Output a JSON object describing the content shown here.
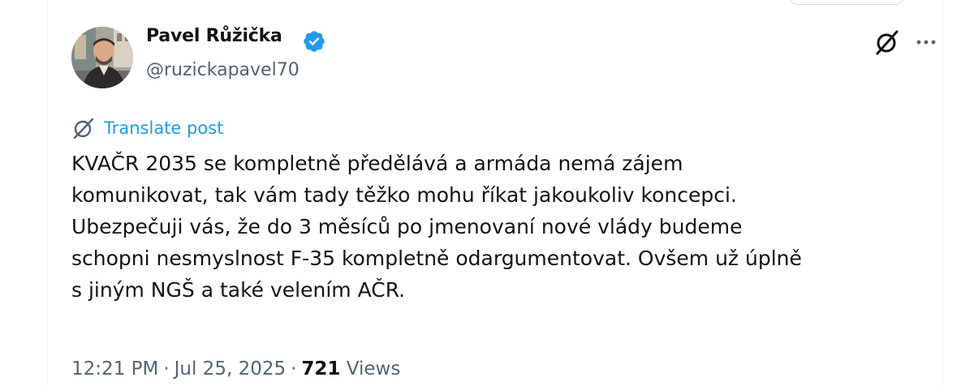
{
  "author": {
    "display_name": "Pavel Růžička",
    "handle": "@ruzickapavel70",
    "verified": true,
    "verified_color": "#1d9bf0"
  },
  "actions": {
    "grok_icon": "grok-icon",
    "more_icon": "more-icon"
  },
  "translate": {
    "label": "Translate post",
    "icon": "translate-icon",
    "color": "#1d9bf0"
  },
  "post": {
    "lines": [
      "KVAČR 2035 se kompletně předělává a armáda nemá zájem",
      "komunikovat, tak vám tady těžko mohu říkat jakoukoliv koncepci.",
      "Ubezpečuji vás, že do 3 měsíců po jmenovaní nové vlády budeme",
      "schopni nesmyslnost F-35 kompletně odargumentovat. Ovšem už úplně",
      "s jiným NGŠ a také velením AČR."
    ]
  },
  "meta": {
    "time": "12:21 PM",
    "separator": "·",
    "date": "Jul 25, 2025",
    "views_count": "721",
    "views_label": "Views"
  }
}
